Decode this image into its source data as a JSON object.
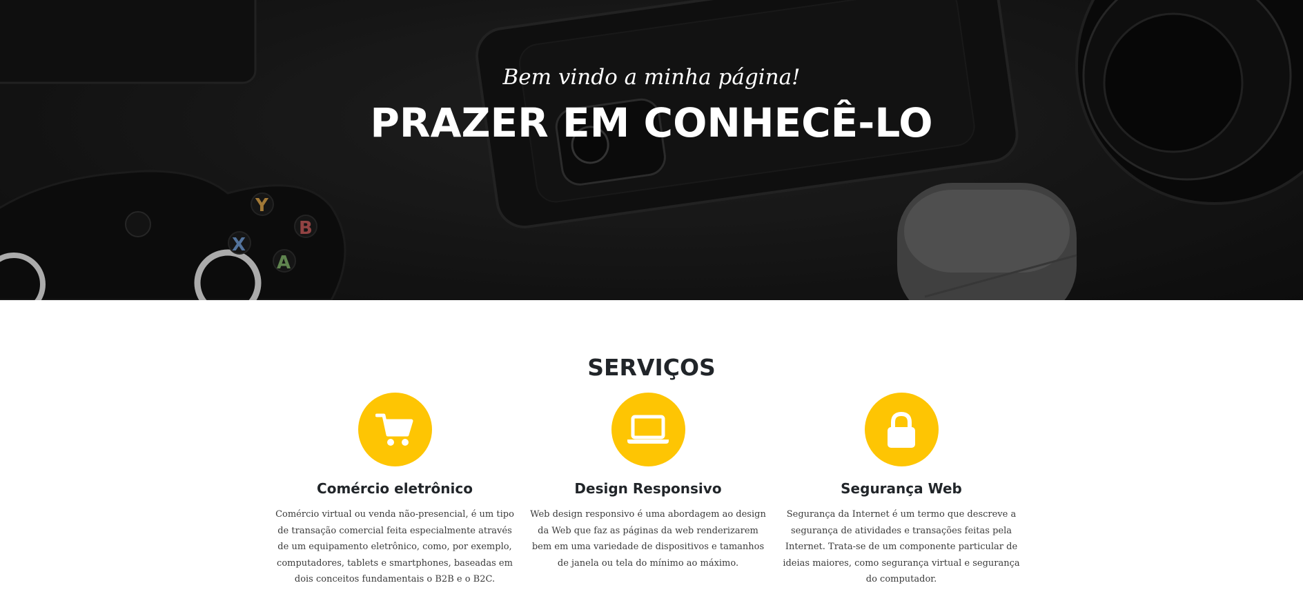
{
  "hero": {
    "subtitle": "Bem vindo a minha página!",
    "title": "PRAZER EM CONHECÊ-LO"
  },
  "services": {
    "title": "SERVIÇOS",
    "accent_color": "#fec503",
    "items": [
      {
        "icon": "shopping-cart-icon",
        "heading": "Comércio eletrônico",
        "text": "Comércio virtual ou venda não-presencial, é um tipo de transação comercial feita especialmente através de um equipamento eletrônico, como, por exemplo, computadores, tablets e smartphones, baseadas em dois conceitos fundamentais o B2B e o B2C."
      },
      {
        "icon": "laptop-icon",
        "heading": "Design Responsivo",
        "text": "Web design responsivo é uma abordagem ao design da Web que faz as páginas da web renderizarem bem em uma variedade de dispositivos e tamanhos de janela ou tela do mínimo ao máximo."
      },
      {
        "icon": "lock-icon",
        "heading": "Segurança Web",
        "text": "Segurança da Internet é um termo que descreve a segurança de atividades e transações feitas pela Internet. Trata-se de um componente particular de ideias maiores, como segurança virtual e segurança do computador."
      }
    ]
  }
}
